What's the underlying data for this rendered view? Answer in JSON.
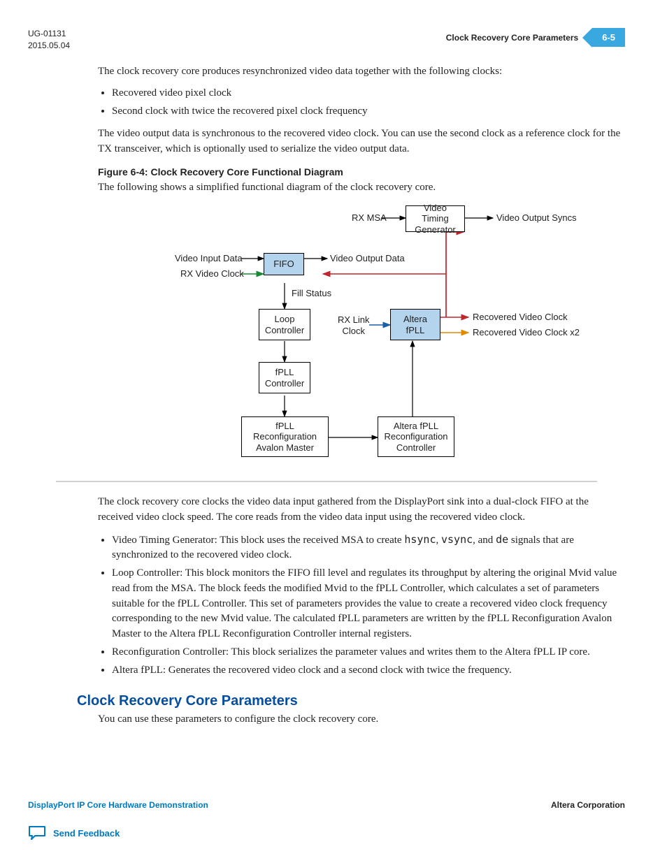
{
  "header": {
    "docnum": "UG-01131",
    "date": "2015.05.04",
    "title": "Clock Recovery Core Parameters",
    "pagenum": "6-5"
  },
  "intro": "The clock recovery core produces resynchronized video data together with the following clocks:",
  "intro_bullets": [
    "Recovered video pixel clock",
    "Second clock with twice the recovered pixel clock frequency"
  ],
  "intro2": "The video output data is synchronous to the recovered video clock. You can use the second clock as a reference clock for the TX transceiver, which is optionally used to serialize the video output data.",
  "figcaption": "Figure 6-4: Clock Recovery Core Functional Diagram",
  "figintro": "The following shows a simplified functional diagram of the clock recovery core.",
  "diagram": {
    "boxes": {
      "vtg": "Video Timing\nGenerator",
      "fifo": "FIFO",
      "loop": "Loop\nController",
      "fpllc": "fPLL\nController",
      "fpllr": "fPLL\nReconfiguration\nAvalon Master",
      "afpll": "Altera fPLL",
      "afpllr": "Altera fPLL\nReconfiguration\nController"
    },
    "labels": {
      "rxmsa": "RX MSA",
      "vosync": "Video Output Syncs",
      "vindata": "Video Input Data",
      "vodata": "Video Output Data",
      "rxvclk": "RX Video Clock",
      "fill": "Fill Status",
      "rxlink": "RX Link\nClock",
      "rvc": "Recovered Video Clock",
      "rvc2": "Recovered Video Clock x2"
    }
  },
  "after_fig": "The clock recovery core clocks the video data input gathered from the DisplayPort sink into a dual-clock FIFO at the received video clock speed. The core reads from the video data input using the recovered video clock.",
  "bullets2_a1": "Video Timing Generator: This block uses the received MSA to create ",
  "bullets2_a2": ", ",
  "bullets2_a3": ", and ",
  "bullets2_a4": " signals that are synchronized to the recovered video clock.",
  "bullets2_b": "Loop Controller: This block monitors the FIFO fill level and regulates its throughput by altering the original Mvid value read from the MSA. The block feeds the modified Mvid to the fPLL Controller, which calculates a set of parameters suitable for the fPLL Controller. This set of parameters provides the value to create a recovered video clock frequency corresponding to the new Mvid value. The calculated fPLL parameters are written by the fPLL Reconfiguration Avalon Master to the Altera fPLL Reconfiguration Controller internal registers.",
  "bullets2_c": "Reconfiguration Controller: This block serializes the parameter values and writes them to the Altera fPLL IP core.",
  "bullets2_d": "Altera fPLL: Generates the recovered video clock and a second clock with twice the frequency.",
  "section_heading": "Clock Recovery Core Parameters",
  "section_intro": "You can use these parameters to configure the clock recovery core.",
  "footer": {
    "left": "DisplayPort IP Core Hardware Demonstration",
    "right": "Altera Corporation",
    "feedback": "Send Feedback"
  }
}
